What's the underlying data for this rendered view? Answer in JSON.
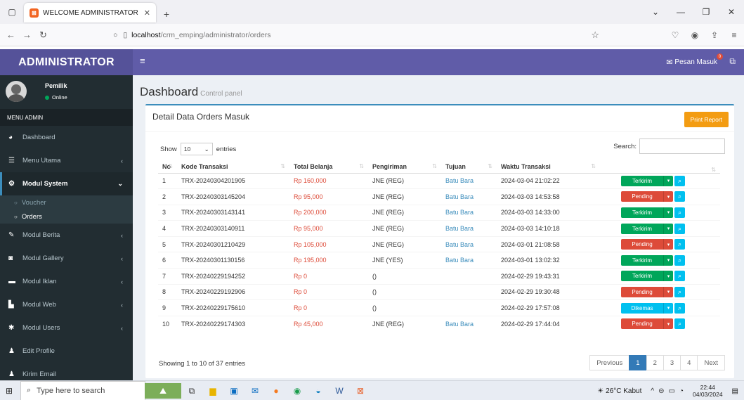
{
  "browser": {
    "tab_title": "WELCOME ADMINISTRATOR",
    "tab_favicon": "x-app-icon",
    "url_host": "localhost",
    "url_path": "/crm_emping/administrator/orders"
  },
  "header": {
    "brand": "ADMINISTRATOR",
    "messages_label": "Pesan Masuk",
    "messages_count": "0"
  },
  "sidebar": {
    "user_name": "Pemilik",
    "user_status": "Online",
    "menu_header": "MENU ADMIN",
    "items": [
      {
        "label": "Dashboard",
        "icon": "dashboard-icon"
      },
      {
        "label": "Menu Utama",
        "icon": "list-icon"
      },
      {
        "label": "Modul System",
        "icon": "gears-icon"
      },
      {
        "label": "Modul Berita",
        "icon": "pencil-icon"
      },
      {
        "label": "Modul Gallery",
        "icon": "camera-icon"
      },
      {
        "label": "Modul Iklan",
        "icon": "window-icon"
      },
      {
        "label": "Modul Web",
        "icon": "bar-chart-icon"
      },
      {
        "label": "Modul Users",
        "icon": "gear-icon"
      },
      {
        "label": "Edit Profile",
        "icon": "user-icon"
      },
      {
        "label": "Kirim Email",
        "icon": "user-icon"
      }
    ],
    "subitems": [
      "Voucher",
      "Orders"
    ]
  },
  "page": {
    "title": "Dashboard",
    "subtitle": "Control panel"
  },
  "box": {
    "title": "Detail Data Orders Masuk",
    "print_label": "Print Report",
    "show_label": "Show",
    "entries_value": "10",
    "entries_label": "entries",
    "search_label": "Search:",
    "showing_text": "Showing 1 to 10 of 37 entries"
  },
  "table": {
    "headers": [
      "No",
      "Kode Transaksi",
      "Total Belanja",
      "Pengiriman",
      "Tujuan",
      "Waktu Transaksi",
      ""
    ],
    "rows": [
      {
        "no": "1",
        "kode": "TRX-20240304201905",
        "total": "Rp 160,000",
        "kirim": "JNE (REG)",
        "tujuan": "Batu Bara",
        "waktu": "2024-03-04 21:02:22",
        "status": "Terkirim"
      },
      {
        "no": "2",
        "kode": "TRX-20240303145204",
        "total": "Rp 95,000",
        "kirim": "JNE (REG)",
        "tujuan": "Batu Bara",
        "waktu": "2024-03-03 14:53:58",
        "status": "Pending"
      },
      {
        "no": "3",
        "kode": "TRX-20240303143141",
        "total": "Rp 200,000",
        "kirim": "JNE (REG)",
        "tujuan": "Batu Bara",
        "waktu": "2024-03-03 14:33:00",
        "status": "Terkirim"
      },
      {
        "no": "4",
        "kode": "TRX-20240303140911",
        "total": "Rp 95,000",
        "kirim": "JNE (REG)",
        "tujuan": "Batu Bara",
        "waktu": "2024-03-03 14:10:18",
        "status": "Terkirim"
      },
      {
        "no": "5",
        "kode": "TRX-20240301210429",
        "total": "Rp 105,000",
        "kirim": "JNE (REG)",
        "tujuan": "Batu Bara",
        "waktu": "2024-03-01 21:08:58",
        "status": "Pending"
      },
      {
        "no": "6",
        "kode": "TRX-20240301130156",
        "total": "Rp 195,000",
        "kirim": "JNE (YES)",
        "tujuan": "Batu Bara",
        "waktu": "2024-03-01 13:02:32",
        "status": "Terkirim"
      },
      {
        "no": "7",
        "kode": "TRX-20240229194252",
        "total": "Rp 0",
        "kirim": "()",
        "tujuan": "",
        "waktu": "2024-02-29 19:43:31",
        "status": "Terkirim"
      },
      {
        "no": "8",
        "kode": "TRX-20240229192906",
        "total": "Rp 0",
        "kirim": "()",
        "tujuan": "",
        "waktu": "2024-02-29 19:30:48",
        "status": "Pending"
      },
      {
        "no": "9",
        "kode": "TRX-20240229175610",
        "total": "Rp 0",
        "kirim": "()",
        "tujuan": "",
        "waktu": "2024-02-29 17:57:08",
        "status": "Dikemas"
      },
      {
        "no": "10",
        "kode": "TRX-20240229174303",
        "total": "Rp 45,000",
        "kirim": "JNE (REG)",
        "tujuan": "Batu Bara",
        "waktu": "2024-02-29 17:44:04",
        "status": "Pending"
      }
    ]
  },
  "status_colors": {
    "Terkirim": "#00a65a",
    "Pending": "#dd4b39",
    "Dikemas": "#00c0ef"
  },
  "pagination": [
    "Previous",
    "1",
    "2",
    "3",
    "4",
    "Next"
  ],
  "taskbar": {
    "search_placeholder": "Type here to search",
    "weather": "26°C  Kabut",
    "time": "22:44",
    "date": "04/03/2024"
  },
  "colors": {
    "header": "#605ca8",
    "sidebar": "#222d32",
    "print_button": "#f39c12",
    "price": "#dd4b39",
    "link": "#3c8dbc"
  }
}
